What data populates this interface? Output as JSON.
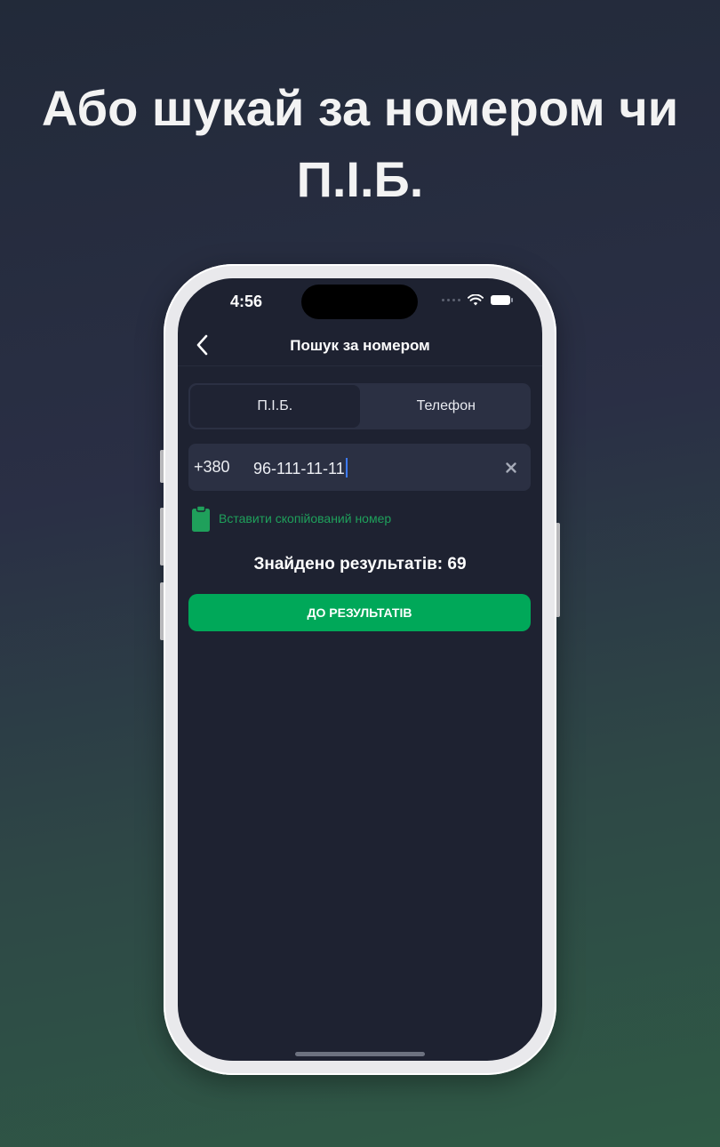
{
  "headline": {
    "line1": "Або шукай за номером чи",
    "line2": "П.І.Б."
  },
  "status_bar": {
    "time": "4:56"
  },
  "nav": {
    "title": "Пошук за номером"
  },
  "tabs": [
    {
      "label": "П.І.Б.",
      "active": true
    },
    {
      "label": "Телефон",
      "active": false
    }
  ],
  "phone_field": {
    "prefix": "+380",
    "value": "96-111-11-11"
  },
  "paste": {
    "label": "Вставити скопійований номер"
  },
  "results": {
    "count_text": "Знайдено результатів: 69",
    "button_label": "ДО РЕЗУЛЬТАТІВ"
  },
  "colors": {
    "accent_green": "#00a859",
    "paste_green": "#1fa05b",
    "screen_bg": "#1e2231",
    "field_bg": "#2b3043",
    "caret": "#3d7bff"
  },
  "icons": [
    "back-chevron-icon",
    "wifi-icon",
    "battery-icon",
    "clear-icon",
    "clipboard-icon"
  ]
}
